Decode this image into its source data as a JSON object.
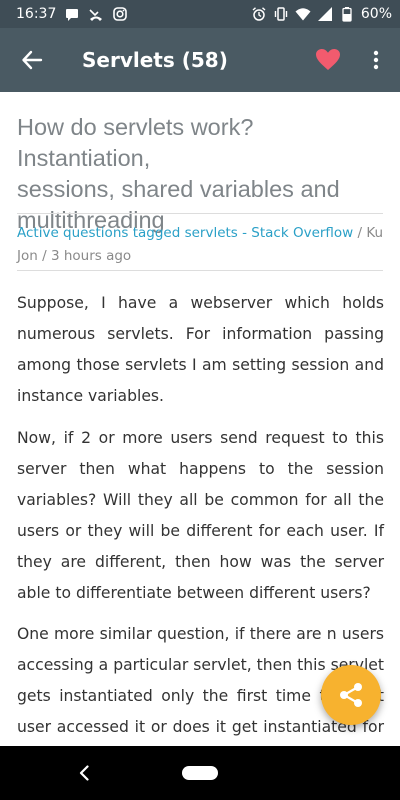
{
  "status_bar": {
    "time": "16:37",
    "battery": "60%",
    "left_icons": [
      "message-icon",
      "missed-call-icon",
      "instagram-icon"
    ],
    "right_icons": [
      "alarm-icon",
      "vibrate-icon",
      "wifi-icon",
      "signal-icon",
      "battery-icon"
    ]
  },
  "app_bar": {
    "title": "Servlets (58)",
    "back_icon": "arrow-left-icon",
    "favorite_icon": "heart-icon",
    "favorite_color": "#f25b6e",
    "more_icon": "more-vert-icon"
  },
  "article": {
    "title_lines": [
      "How do servlets work? Instantiation,",
      "sessions, shared variables and",
      "multithreading"
    ],
    "source": "Active questions tagged servlets - Stack Overflow",
    "meta_sep": " / ",
    "author": "Ku Jon",
    "time": "3 hours ago",
    "paragraphs": [
      "Suppose, I have a webserver which holds numerous servlets. For information passing among those servlets I am setting session and instance variables.",
      "Now, if 2 or more users send request to this server then what happens to the session variables? Will they all be common for all the users or they will be different for each user. If they are different, then how was the server able to differentiate between different users?",
      "One more similar question, if there are n users accessing a particular servlet, then this servlet gets instantiated only the first time the first user accessed it or does it get instantiated for all the users separately? In"
    ]
  },
  "fab": {
    "icon": "share-icon",
    "color": "#f7b22f"
  },
  "nav_bar": {
    "back_icon": "nav-back-icon",
    "home_icon": "nav-home-pill"
  }
}
